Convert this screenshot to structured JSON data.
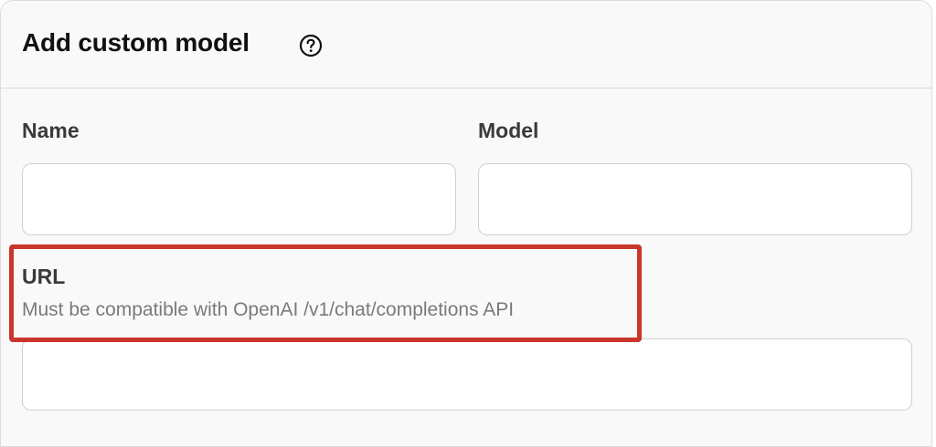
{
  "dialog": {
    "title": "Add custom model"
  },
  "icons": {
    "help": "question-circle-icon"
  },
  "fields": {
    "name": {
      "label": "Name",
      "value": "",
      "placeholder": ""
    },
    "model": {
      "label": "Model",
      "value": "",
      "placeholder": ""
    },
    "url": {
      "label": "URL",
      "hint": "Must be compatible with OpenAI /v1/chat/completions API",
      "value": "",
      "placeholder": ""
    }
  },
  "colors": {
    "highlight_border": "#c9362b",
    "panel_background": "#f9f9f9"
  }
}
